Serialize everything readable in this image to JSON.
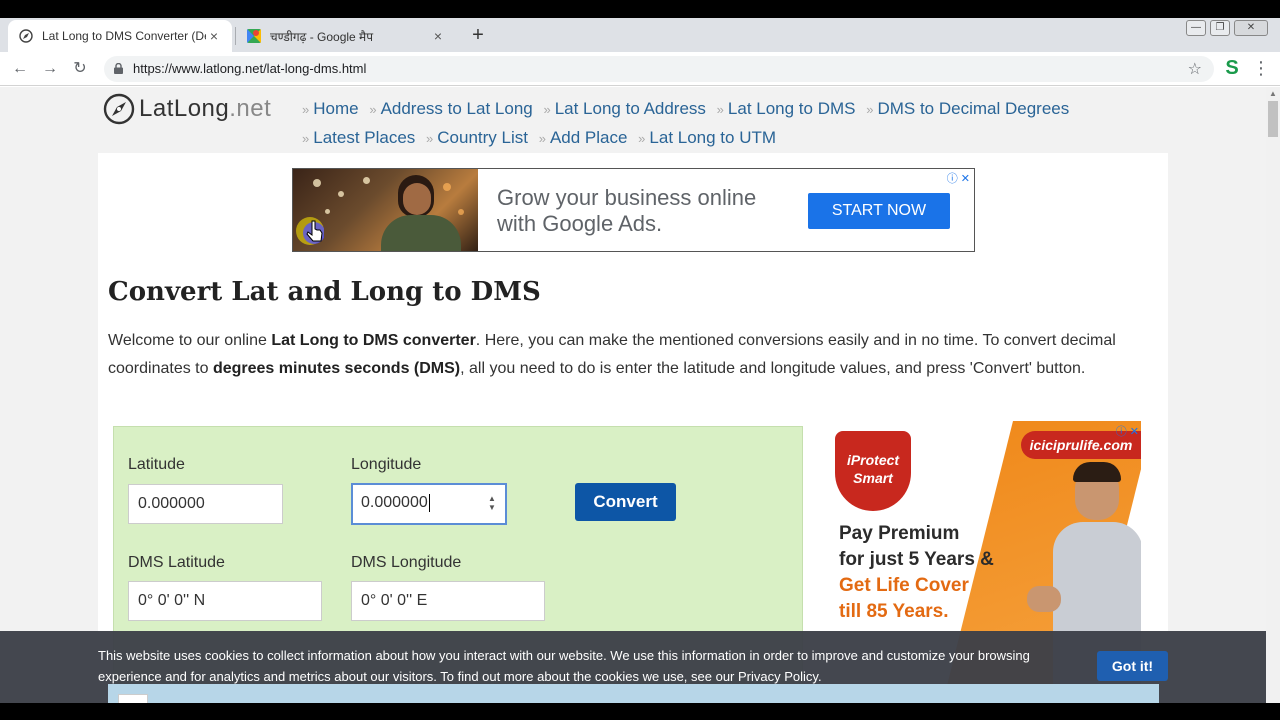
{
  "browser": {
    "tabs": [
      {
        "title": "Lat Long to DMS Converter (Dec",
        "active": true,
        "icon": "compass-icon"
      },
      {
        "title": "चण्डीगढ़ - Google मैप",
        "active": false,
        "icon": "google-maps-icon"
      }
    ],
    "close_glyph": "×",
    "new_tab_glyph": "+",
    "url": "https://www.latlong.net/lat-long-dms.html",
    "extension_label": "S"
  },
  "site": {
    "logo_main": "LatLong",
    "logo_suffix": ".net",
    "nav": [
      "Home",
      "Address to Lat Long",
      "Lat Long to Address",
      "Lat Long to DMS",
      "DMS to Decimal Degrees",
      "Latest Places",
      "Country List",
      "Add Place",
      "Lat Long to UTM"
    ],
    "nav_separator": "»"
  },
  "ad_top": {
    "headline_line1": "Grow your business online",
    "headline_line2": "with Google Ads.",
    "cta": "START NOW",
    "adchoices": "ⓘ ✕"
  },
  "main": {
    "title": "Convert Lat and Long to DMS",
    "intro": {
      "p1": "Welcome to our online ",
      "b1": "Lat Long to DMS converter",
      "p2": ". Here, you can make the mentioned conversions easily and in no time. To convert decimal coordinates to ",
      "b2": "degrees minutes seconds (DMS)",
      "p3": ", all you need to do is enter the latitude and longitude values, and press 'Convert' button."
    }
  },
  "form": {
    "latitude_label": "Latitude",
    "latitude_value": "0.000000",
    "longitude_label": "Longitude",
    "longitude_value": "0.000000",
    "convert_label": "Convert",
    "dms_lat_label": "DMS Latitude",
    "dms_lat_value": "0° 0' 0'' N",
    "dms_long_label": "DMS Longitude",
    "dms_long_value": "0° 0' 0'' E"
  },
  "ad_side": {
    "badge_line1": "iProtect",
    "badge_line2": "Smart",
    "brand": "iciciprulife.com",
    "line1": "Pay Premium",
    "line2": "for just 5 Years &",
    "line3": "Get Life Cover",
    "line4": "till 85 Years.",
    "adchoices": "ⓘ ✕"
  },
  "cookie": {
    "message": "This website uses cookies to collect information about how you interact with our website. We use this information in order to improve and customize your browsing experience and for analytics and metrics about our visitors. To find out more about the cookies we use, see our ",
    "link": "Privacy Policy",
    "end": ".",
    "button": "Got it!"
  },
  "colors": {
    "link": "#2a6496",
    "form_bg": "#d9f0c5",
    "convert_button": "#0d56a6",
    "ad_cta": "#1a73e8",
    "cookie_bg": "#3c4048"
  }
}
